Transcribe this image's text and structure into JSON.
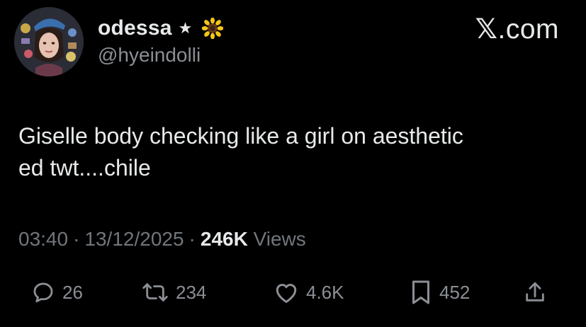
{
  "user": {
    "display_name": "odessa",
    "name_badge": "★",
    "name_emoji_icon": "sunflower-icon",
    "handle": "@hyeindolli"
  },
  "brand": {
    "x_mark": "𝕏",
    "suffix": ".com"
  },
  "tweet": {
    "text_line1": "Giselle body checking like a girl on aesthetic",
    "text_line2": "ed twt....chile"
  },
  "meta": {
    "time": "03:40",
    "date": "13/12/2025",
    "separator": "·",
    "views_count": "246K",
    "views_label": "Views"
  },
  "actions": {
    "replies": "26",
    "reposts": "234",
    "likes": "4.6K",
    "bookmarks": "452"
  },
  "icons": {
    "reply": "reply-icon",
    "repost": "repost-icon",
    "like": "heart-icon",
    "bookmark": "bookmark-icon",
    "share": "share-icon"
  },
  "colors": {
    "background": "#000000",
    "primary_text": "#e7e9ea",
    "secondary_text": "#71767b"
  }
}
